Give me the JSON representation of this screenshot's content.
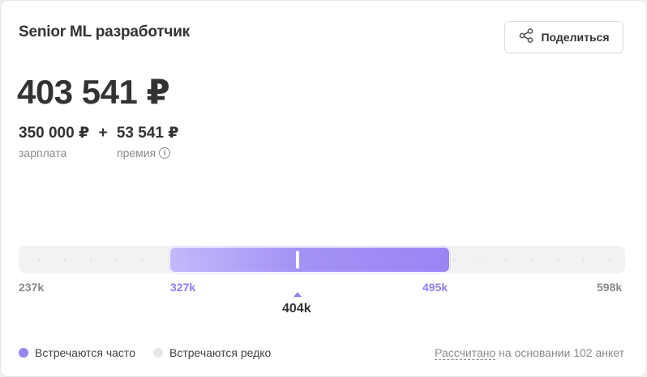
{
  "title": "Senior ML разработчик",
  "share": {
    "label": "Поделиться",
    "icon": "share-icon"
  },
  "total": "403 541 ₽",
  "salary": {
    "value": "350 000 ₽",
    "caption": "зарплата"
  },
  "plus": "+",
  "bonus": {
    "value": "53 541 ₽",
    "caption": "премия",
    "info_icon": "info-icon",
    "info_glyph": "i"
  },
  "range": {
    "min_label": "237k",
    "q1_label": "327k",
    "median_label": "404k",
    "q3_label": "495k",
    "max_label": "598k"
  },
  "legend": {
    "frequent": {
      "label": "Встречаются часто",
      "color": "#9b84f4"
    },
    "rare": {
      "label": "Встречаются редко",
      "color": "#e6e6ea"
    }
  },
  "footer": {
    "link": "Рассчитано",
    "text": " на основании 102 анкет"
  },
  "colors": {
    "accent": "#9b84f4",
    "accent_light": "#c4b8fb",
    "muted": "#8a8a8e"
  }
}
